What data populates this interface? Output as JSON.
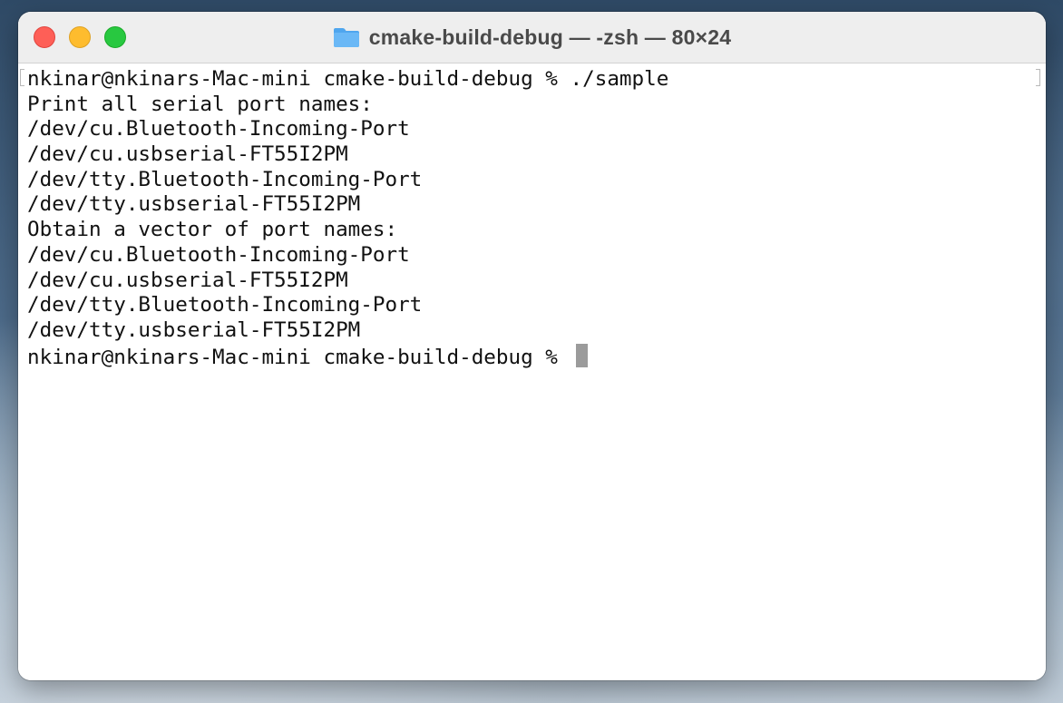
{
  "window": {
    "title": "cmake-build-debug — -zsh — 80×24",
    "icon": "folder-icon",
    "colors": {
      "close": "#fe5f57",
      "minimize": "#febc2e",
      "zoom": "#28c840",
      "folder": "#5aaef2"
    }
  },
  "terminal": {
    "lines": [
      "nkinar@nkinars-Mac-mini cmake-build-debug % ./sample",
      "Print all serial port names:",
      "/dev/cu.Bluetooth-Incoming-Port",
      "/dev/cu.usbserial-FT55I2PM",
      "/dev/tty.Bluetooth-Incoming-Port",
      "/dev/tty.usbserial-FT55I2PM",
      "Obtain a vector of port names:",
      "/dev/cu.Bluetooth-Incoming-Port",
      "/dev/cu.usbserial-FT55I2PM",
      "/dev/tty.Bluetooth-Incoming-Port",
      "/dev/tty.usbserial-FT55I2PM"
    ],
    "prompt": "nkinar@nkinars-Mac-mini cmake-build-debug % "
  }
}
